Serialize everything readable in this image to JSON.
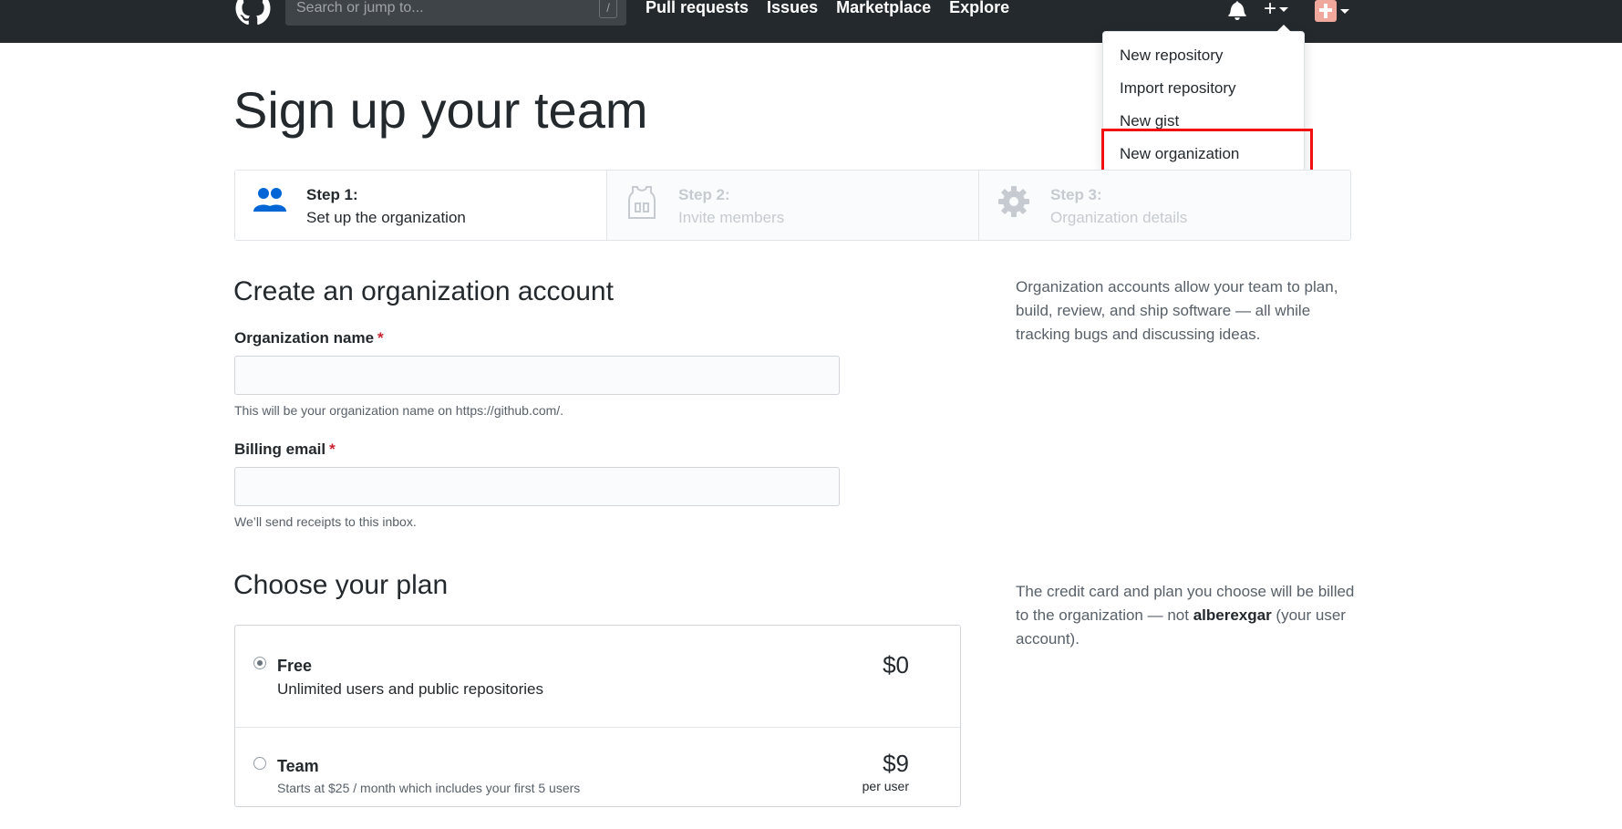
{
  "header": {
    "search_placeholder": "Search or jump to...",
    "search_shortcut": "/",
    "nav": [
      "Pull requests",
      "Issues",
      "Marketplace",
      "Explore"
    ],
    "plus_symbol": "+"
  },
  "dropdown": {
    "items": [
      "New repository",
      "Import repository",
      "New gist",
      "New organization"
    ],
    "highlighted_item": "New organization"
  },
  "page": {
    "title": "Sign up your team"
  },
  "steps": [
    {
      "title": "Step 1:",
      "subtitle": "Set up the organization",
      "state": "active",
      "icon": "people-icon"
    },
    {
      "title": "Step 2:",
      "subtitle": "Invite members",
      "state": "inactive",
      "icon": "jersey-icon"
    },
    {
      "title": "Step 3:",
      "subtitle": "Organization details",
      "state": "inactive",
      "icon": "gear-icon"
    }
  ],
  "account_section": {
    "heading": "Create an organization account",
    "org_name_label": "Organization name",
    "org_name_value": "",
    "org_name_note": "This will be your organization name on https://github.com/.",
    "billing_email_label": "Billing email",
    "billing_email_value": "",
    "billing_email_note": "We’ll send receipts to this inbox.",
    "required_marker": "*",
    "aside": "Organization accounts allow your team to plan, build, review, and ship software — all while tracking bugs and discussing ideas."
  },
  "plan_section": {
    "heading": "Choose your plan",
    "aside_prefix": "The credit card and plan you choose will be billed to the organization — not ",
    "aside_user": "alberexgar",
    "aside_suffix": " (your user account).",
    "plans": [
      {
        "name": "Free",
        "description": "Unlimited users and public repositories",
        "price": "$0",
        "selected": true
      },
      {
        "name": "Team",
        "description": "Starts at $25 / month which includes your first 5 users",
        "price": "$9",
        "per": "per user",
        "selected": false
      }
    ]
  },
  "colors": {
    "header_bg": "#24292e",
    "highlight": "#f01010",
    "step_active_icon": "#0366d6",
    "required": "#cb2431"
  }
}
